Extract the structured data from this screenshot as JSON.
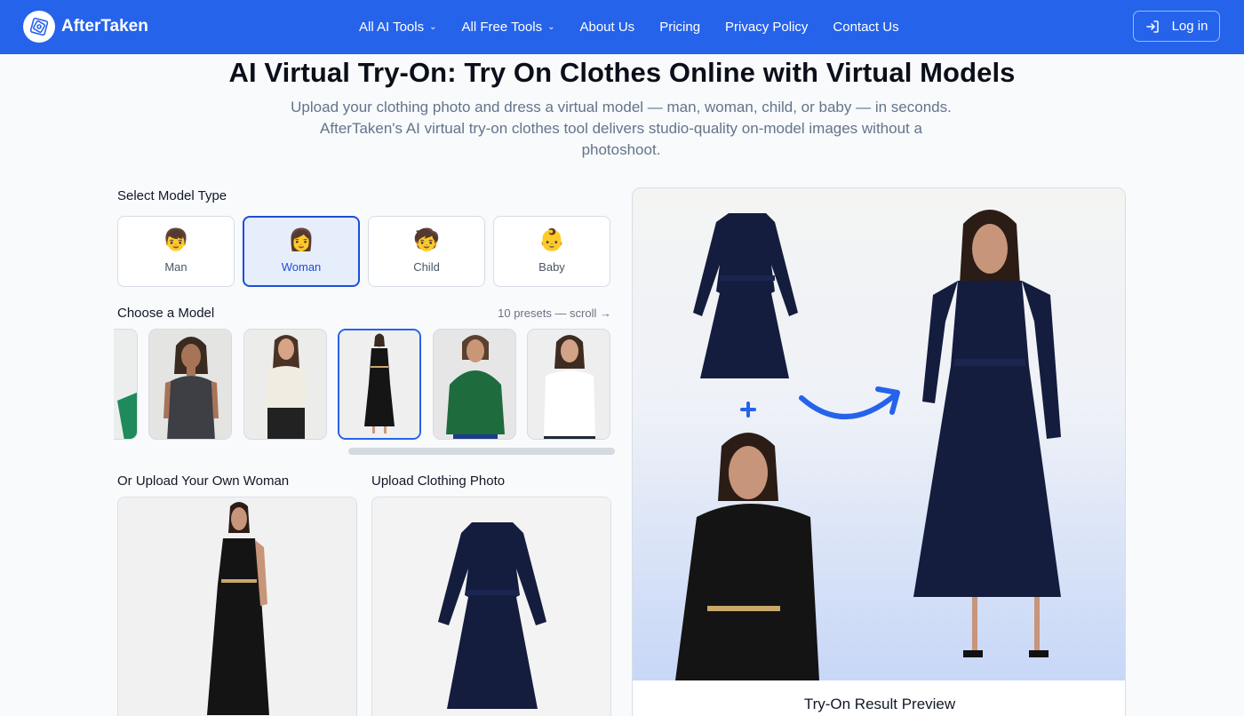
{
  "nav": {
    "brand": "AfterTaken",
    "links": [
      {
        "label": "All AI Tools",
        "dropdown": true
      },
      {
        "label": "All Free Tools",
        "dropdown": true
      },
      {
        "label": "About Us",
        "dropdown": false
      },
      {
        "label": "Pricing",
        "dropdown": false
      },
      {
        "label": "Privacy Policy",
        "dropdown": false
      },
      {
        "label": "Contact Us",
        "dropdown": false
      }
    ],
    "login_label": "Log in"
  },
  "hero": {
    "title": "AI Virtual Try-On: Try On Clothes Online with Virtual Models",
    "subtitle": "Upload your clothing photo and dress a virtual model — man, woman, child, or baby — in seconds. AfterTaken's AI virtual try-on clothes tool delivers studio-quality on-model images without a photoshoot."
  },
  "model_type": {
    "label": "Select Model Type",
    "options": [
      {
        "label": "Man",
        "icon": "👦",
        "selected": false
      },
      {
        "label": "Woman",
        "icon": "👩",
        "selected": true
      },
      {
        "label": "Child",
        "icon": "🧒",
        "selected": false
      },
      {
        "label": "Baby",
        "icon": "👶",
        "selected": false
      }
    ]
  },
  "choose_model": {
    "label": "Choose a Model",
    "hint": "10 presets — scroll →"
  },
  "upload_model": {
    "label": "Or Upload Your Own Woman"
  },
  "upload_clothing": {
    "label": "Upload Clothing Photo"
  },
  "preview": {
    "caption": "Try-On Result Preview"
  },
  "colors": {
    "primary": "#2563eb",
    "selected_border": "#1d4ed8",
    "selected_bg": "#e7eefb",
    "navy_dress": "#141d3d",
    "black_dress": "#141414"
  }
}
